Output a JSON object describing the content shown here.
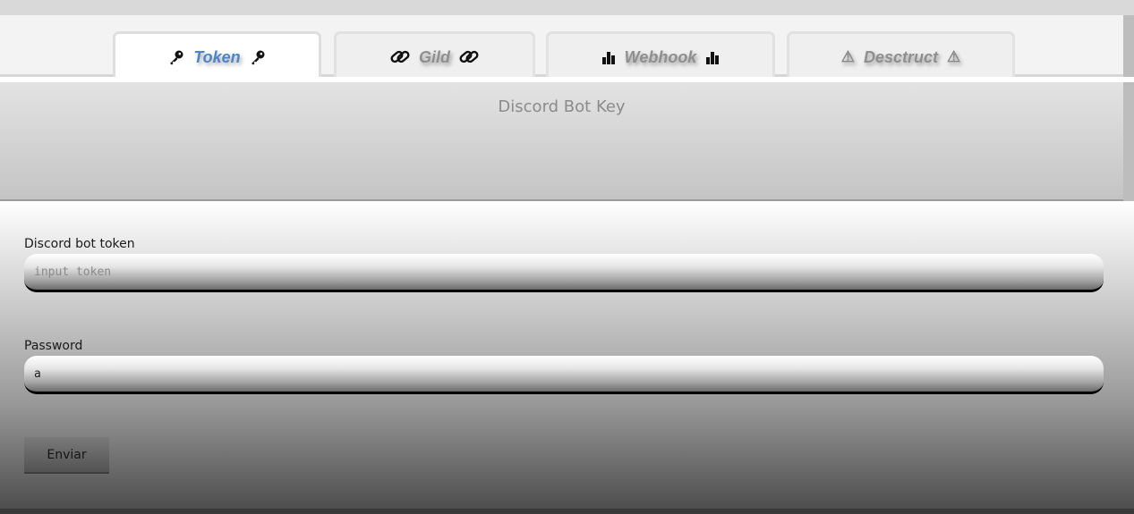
{
  "tabs": [
    {
      "label": "Token",
      "icon": "key-icon",
      "active": true
    },
    {
      "label": "Gild",
      "icon": "link-icon",
      "active": false
    },
    {
      "label": "Webhook",
      "icon": "bar-chart-icon",
      "active": false
    },
    {
      "label": "Desctruct",
      "icon": "warning-icon",
      "active": false
    }
  ],
  "header": {
    "title": "Discord Bot Key"
  },
  "form": {
    "token_label": "Discord bot token",
    "token_placeholder": "input token",
    "token_value": "",
    "password_label": "Password",
    "password_value": "a",
    "submit_label": "Enviar"
  },
  "colors": {
    "active_tab_text": "#4f84c9",
    "inactive_tab_text": "#8f8f8f"
  }
}
